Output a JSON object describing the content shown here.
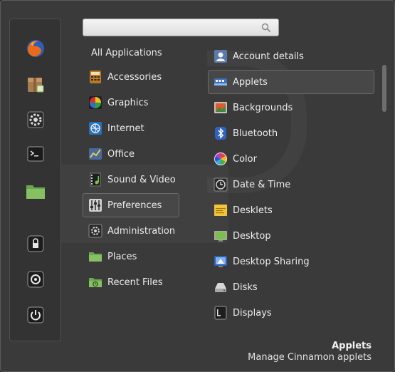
{
  "search": {
    "value": "",
    "placeholder": ""
  },
  "favorites": [
    {
      "name": "firefox-icon"
    },
    {
      "name": "archive-manager-icon"
    },
    {
      "name": "system-settings-icon"
    },
    {
      "name": "terminal-icon"
    },
    {
      "name": "files-folder-icon"
    },
    {
      "name": "lock-screen-icon"
    },
    {
      "name": "logout-icon"
    },
    {
      "name": "shutdown-icon"
    }
  ],
  "categories": {
    "all": "All Applications",
    "items": [
      {
        "label": "Accessories"
      },
      {
        "label": "Graphics"
      },
      {
        "label": "Internet"
      },
      {
        "label": "Office"
      },
      {
        "label": "Sound & Video"
      },
      {
        "label": "Preferences",
        "selected": true
      },
      {
        "label": "Administration"
      },
      {
        "label": "Places"
      },
      {
        "label": "Recent Files"
      }
    ]
  },
  "apps": [
    {
      "label": "Account details"
    },
    {
      "label": "Applets",
      "selected": true
    },
    {
      "label": "Backgrounds"
    },
    {
      "label": "Bluetooth"
    },
    {
      "label": "Color"
    },
    {
      "label": "Date & Time"
    },
    {
      "label": "Desklets"
    },
    {
      "label": "Desktop"
    },
    {
      "label": "Desktop Sharing"
    },
    {
      "label": "Disks"
    },
    {
      "label": "Displays"
    }
  ],
  "info": {
    "title": "Applets",
    "description": "Manage Cinnamon applets"
  },
  "colors": {
    "panel": "#3a3a3a",
    "selected_bg": "#474747",
    "text": "#ececec"
  }
}
